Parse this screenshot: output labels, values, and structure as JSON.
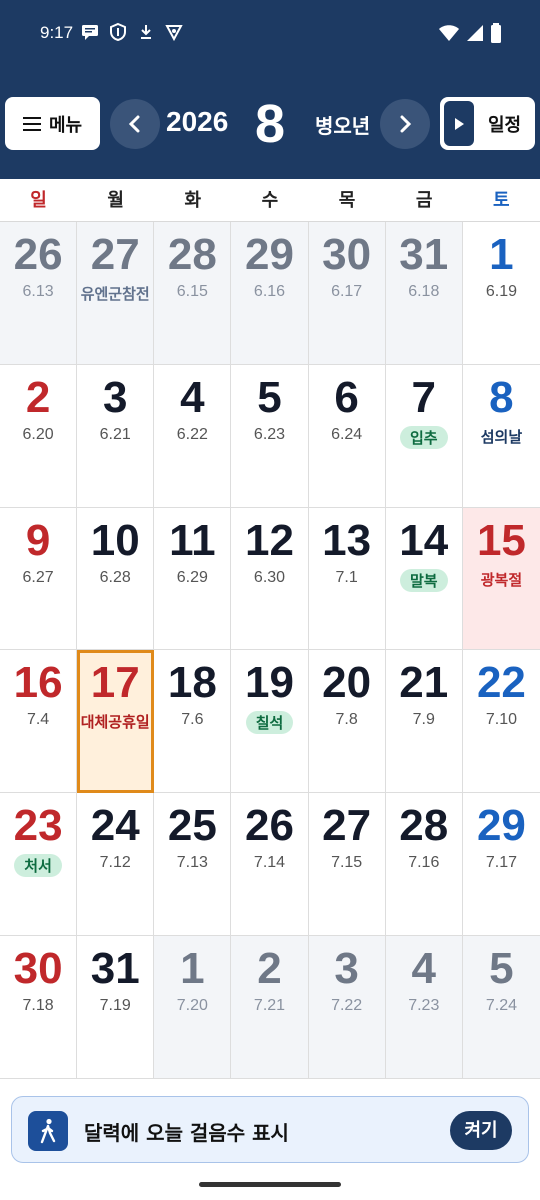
{
  "status_bar": {
    "time": "9:17"
  },
  "header": {
    "menu_label": "메뉴",
    "year": "2026",
    "month": "8",
    "ganji": "병오년",
    "schedule_label": "일정"
  },
  "weekdays": [
    "일",
    "월",
    "화",
    "수",
    "목",
    "금",
    "토"
  ],
  "calendar": {
    "days": [
      {
        "num": "26",
        "lunar": "6.13"
      },
      {
        "num": "27",
        "note": "유엔군참전"
      },
      {
        "num": "28",
        "lunar": "6.15"
      },
      {
        "num": "29",
        "lunar": "6.16"
      },
      {
        "num": "30",
        "lunar": "6.17"
      },
      {
        "num": "31",
        "lunar": "6.18"
      },
      {
        "num": "1",
        "lunar": "6.19"
      },
      {
        "num": "2",
        "lunar": "6.20"
      },
      {
        "num": "3",
        "lunar": "6.21"
      },
      {
        "num": "4",
        "lunar": "6.22"
      },
      {
        "num": "5",
        "lunar": "6.23"
      },
      {
        "num": "6",
        "lunar": "6.24"
      },
      {
        "num": "7",
        "tag": "입추"
      },
      {
        "num": "8",
        "note": "섬의날"
      },
      {
        "num": "9",
        "lunar": "6.27"
      },
      {
        "num": "10",
        "lunar": "6.28"
      },
      {
        "num": "11",
        "lunar": "6.29"
      },
      {
        "num": "12",
        "lunar": "6.30"
      },
      {
        "num": "13",
        "lunar": "7.1"
      },
      {
        "num": "14",
        "tag": "말복"
      },
      {
        "num": "15",
        "note": "광복절"
      },
      {
        "num": "16",
        "lunar": "7.4"
      },
      {
        "num": "17",
        "note": "대체공휴일"
      },
      {
        "num": "18",
        "lunar": "7.6"
      },
      {
        "num": "19",
        "tag": "칠석"
      },
      {
        "num": "20",
        "lunar": "7.8"
      },
      {
        "num": "21",
        "lunar": "7.9"
      },
      {
        "num": "22",
        "lunar": "7.10"
      },
      {
        "num": "23",
        "tag": "처서"
      },
      {
        "num": "24",
        "lunar": "7.12"
      },
      {
        "num": "25",
        "lunar": "7.13"
      },
      {
        "num": "26",
        "lunar": "7.14"
      },
      {
        "num": "27",
        "lunar": "7.15"
      },
      {
        "num": "28",
        "lunar": "7.16"
      },
      {
        "num": "29",
        "lunar": "7.17"
      },
      {
        "num": "30",
        "lunar": "7.18"
      },
      {
        "num": "31",
        "lunar": "7.19"
      },
      {
        "num": "1",
        "lunar": "7.20"
      },
      {
        "num": "2",
        "lunar": "7.21"
      },
      {
        "num": "3",
        "lunar": "7.22"
      },
      {
        "num": "4",
        "lunar": "7.23"
      },
      {
        "num": "5",
        "lunar": "7.24"
      }
    ]
  },
  "banner": {
    "text": "달력에 오늘 걸음수 표시",
    "button": "켜기"
  },
  "colors": {
    "header_bg": "#1d3a63",
    "sunday": "#c0282b",
    "saturday": "#1a62c0",
    "today_border": "#e08a1a",
    "tag_bg": "#cdeedd"
  },
  "icons": [
    "message-icon",
    "shield-icon",
    "download-icon",
    "vpn-icon",
    "wifi-icon",
    "signal-icon",
    "battery-icon",
    "chevron-left-icon",
    "chevron-right-icon",
    "menu-icon",
    "walk-icon"
  ]
}
